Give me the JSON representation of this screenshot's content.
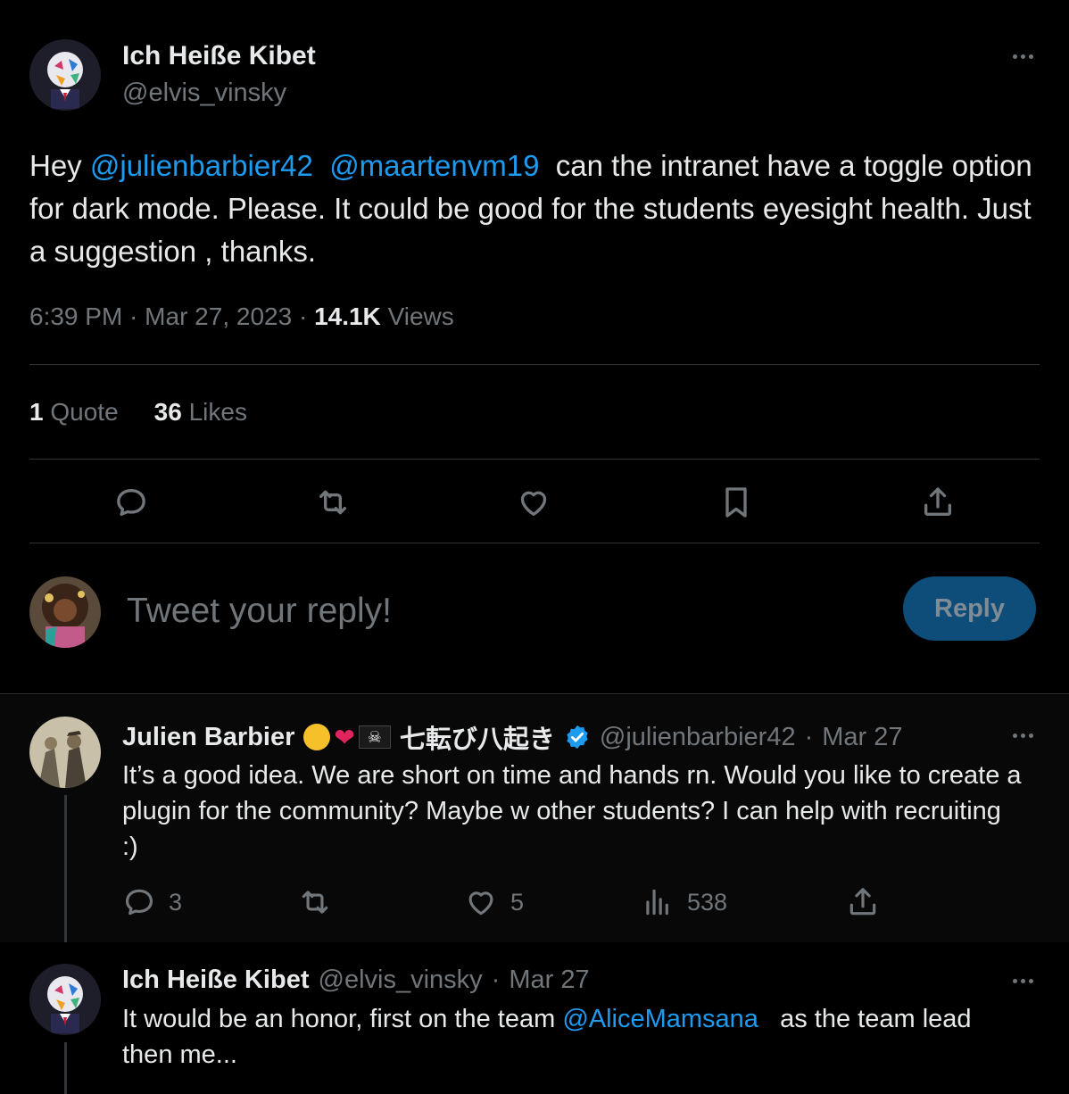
{
  "main_tweet": {
    "author_name": "Ich Heiße Kibet",
    "author_handle": "@elvis_vinsky",
    "text_prefix": "Hey ",
    "mention_1": "@julienbarbier42",
    "mention_2": "@maartenvm19",
    "text_body": " can the intranet have a toggle option for dark mode. Please. It could be good for the students eyesight health. Just a suggestion , thanks.",
    "time": "6:39 PM",
    "date": "Mar 27, 2023",
    "views_count": "14.1K",
    "views_label": "Views",
    "quote_count": "1",
    "quote_label": "Quote",
    "likes_count": "36",
    "likes_label": "Likes"
  },
  "compose": {
    "placeholder": "Tweet your reply!",
    "reply_button": "Reply"
  },
  "replies": [
    {
      "author_name": "Julien Barbier",
      "name_suffix": "七転び八起き",
      "author_handle": "@julienbarbier42",
      "date": "Mar 27",
      "text": "It’s a good idea. We are short on time and hands rn. Would you like to create a plugin for the community? Maybe w other students? I can help with recruiting :)",
      "reply_count": "3",
      "like_count": "5",
      "view_count": "538"
    },
    {
      "author_name": "Ich Heiße Kibet",
      "author_handle": "@elvis_vinsky",
      "date": "Mar 27",
      "text_prefix": "It would be an honor, first on the team ",
      "mention": "@AliceMamsana",
      "text_suffix": " as the team lead then me..."
    }
  ],
  "colors": {
    "background": "#000000",
    "link": "#1d9bf0",
    "muted": "#71767b",
    "reply_button": "#0e4d7a"
  }
}
